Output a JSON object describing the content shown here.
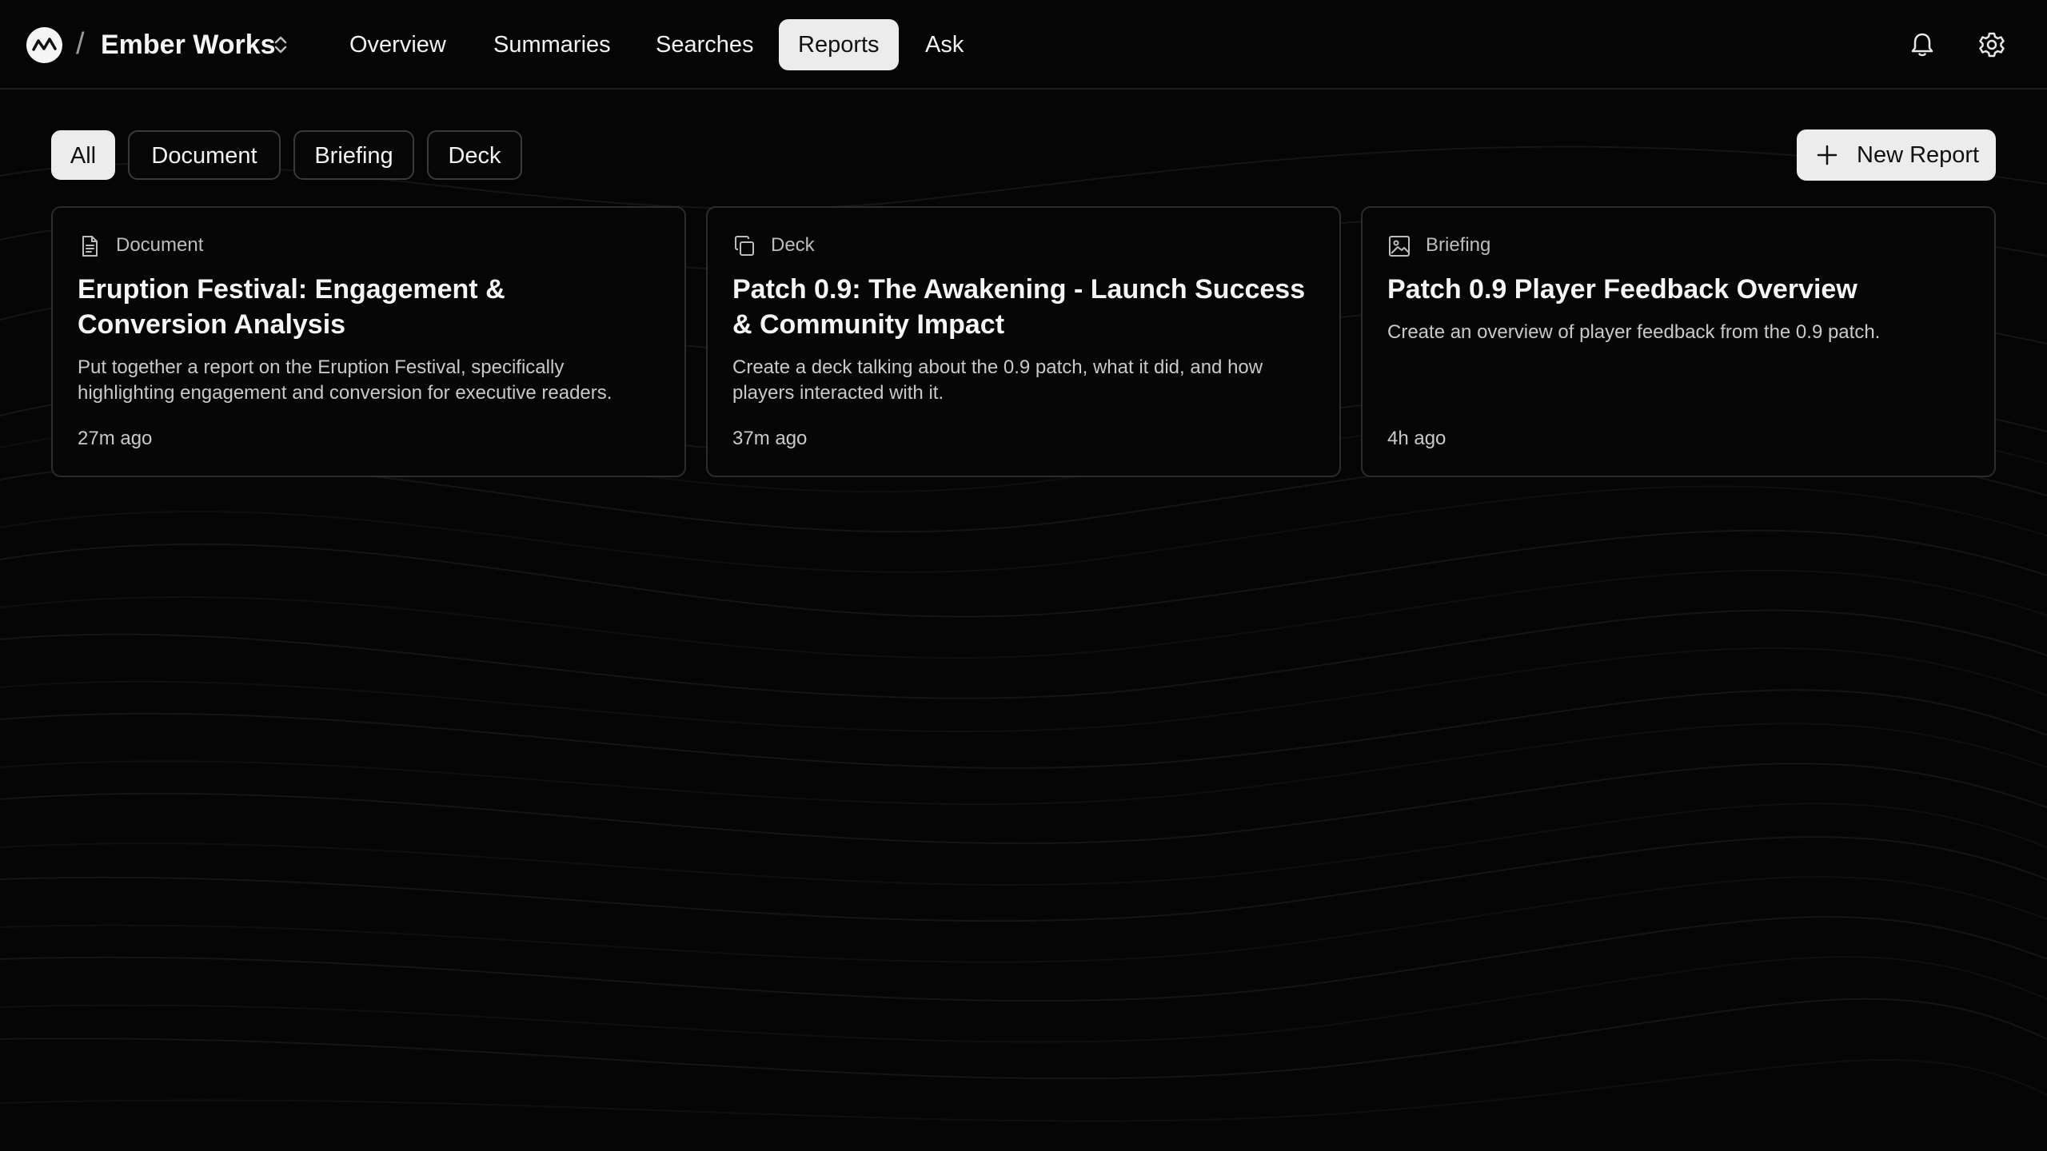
{
  "header": {
    "workspace_name": "Ember Works",
    "separator": "/",
    "nav": [
      {
        "label": "Overview",
        "active": false
      },
      {
        "label": "Summaries",
        "active": false
      },
      {
        "label": "Searches",
        "active": false
      },
      {
        "label": "Reports",
        "active": true
      },
      {
        "label": "Ask",
        "active": false
      }
    ],
    "icons": [
      "app-logo-icon",
      "chevron-up-down-icon",
      "bell-icon",
      "gear-icon"
    ]
  },
  "filters": {
    "chips": [
      {
        "label": "All",
        "active": true
      },
      {
        "label": "Document",
        "active": false
      },
      {
        "label": "Briefing",
        "active": false
      },
      {
        "label": "Deck",
        "active": false
      }
    ],
    "new_report_label": "New Report"
  },
  "reports": [
    {
      "type": "Document",
      "icon": "document-icon",
      "title": "Eruption Festival: Engagement & Conversion Analysis",
      "description": "Put together a report on the Eruption Festival, specifically highlighting engagement and conversion for executive readers.",
      "time": "27m ago"
    },
    {
      "type": "Deck",
      "icon": "copy-deck-icon",
      "title": "Patch 0.9: The Awakening - Launch Success & Community Impact",
      "description": "Create a deck talking about the 0.9 patch, what it did, and how players interacted with it.",
      "time": "37m ago"
    },
    {
      "type": "Briefing",
      "icon": "image-icon",
      "title": "Patch 0.9 Player Feedback Overview",
      "description": "Create an overview of player feedback from the 0.9 patch.",
      "time": "4h ago"
    }
  ],
  "colors": {
    "background": "#050505",
    "active_chip": "#ececec",
    "border": "#2c2c2c",
    "text": "#f2f2f2"
  }
}
